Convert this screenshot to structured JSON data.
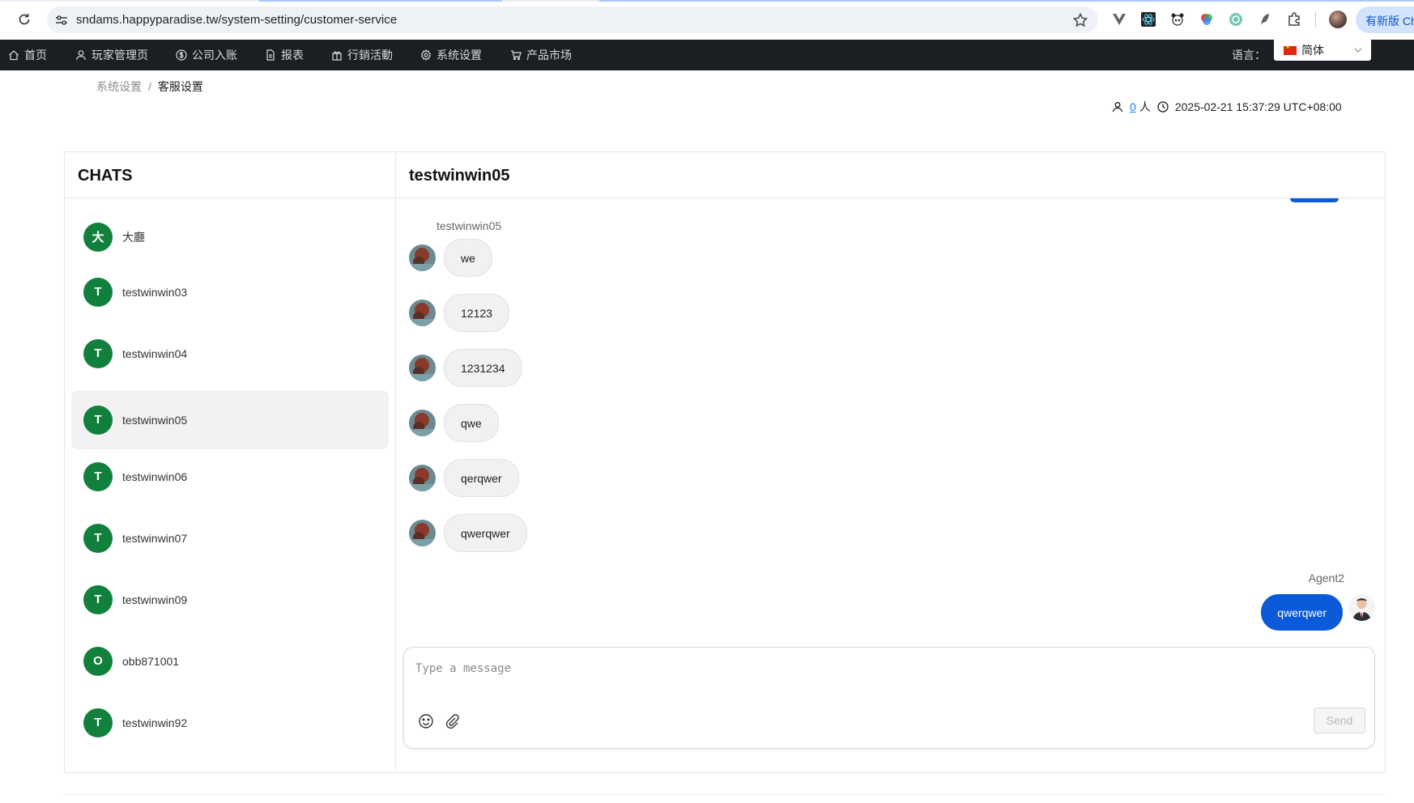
{
  "browser": {
    "url": "sndams.happyparadise.tw/system-setting/customer-service",
    "new_version_label": "有新版 Ch",
    "icons": [
      "reload-icon",
      "site-info-icon",
      "bookmark-star-icon",
      "vue-devtools-icon",
      "react-devtools-icon",
      "panda-extension-icon",
      "color-picker-extension-icon",
      "openai-extension-icon",
      "feather-extension-icon",
      "extensions-puzzle-icon",
      "profile-avatar"
    ]
  },
  "nav": {
    "items": [
      {
        "label": "首页",
        "icon": "home-icon"
      },
      {
        "label": "玩家管理页",
        "icon": "user-icon"
      },
      {
        "label": "公司入账",
        "icon": "dollar-circle-icon"
      },
      {
        "label": "报表",
        "icon": "file-icon"
      },
      {
        "label": "行銷活動",
        "icon": "gift-icon"
      },
      {
        "label": "系统设置",
        "icon": "gear-icon"
      },
      {
        "label": "产品市场",
        "icon": "cart-icon"
      }
    ],
    "language_label": "语言：",
    "language_value": "简体"
  },
  "breadcrumb": {
    "parent": "系统设置",
    "separator": "/",
    "current": "客服设置"
  },
  "status": {
    "online_count": "0",
    "online_unit": "人",
    "datetime": "2025-02-21 15:37:29 UTC+08:00"
  },
  "chats": {
    "title": "CHATS",
    "items": [
      {
        "initial": "大",
        "name": "大廳"
      },
      {
        "initial": "T",
        "name": "testwinwin03"
      },
      {
        "initial": "T",
        "name": "testwinwin04"
      },
      {
        "initial": "T",
        "name": "testwinwin05",
        "active": true
      },
      {
        "initial": "T",
        "name": "testwinwin06"
      },
      {
        "initial": "T",
        "name": "testwinwin07"
      },
      {
        "initial": "T",
        "name": "testwinwin09"
      },
      {
        "initial": "O",
        "name": "obb871001"
      },
      {
        "initial": "T",
        "name": "testwinwin92"
      }
    ]
  },
  "conversation": {
    "title": "testwinwin05",
    "sender_name": "testwinwin05",
    "messages": [
      "we",
      "12123",
      "1231234",
      "qwe",
      "qerqwer",
      "qwerqwer"
    ],
    "agent_name": "Agent2",
    "agent_message": "qwerqwer"
  },
  "composer": {
    "placeholder": "Type a message",
    "send_label": "Send"
  },
  "colors": {
    "nav_bg": "#1b1f23",
    "avatar_green": "#12803d",
    "agent_bubble": "#0b5ad9",
    "link_blue": "#1677ff"
  }
}
